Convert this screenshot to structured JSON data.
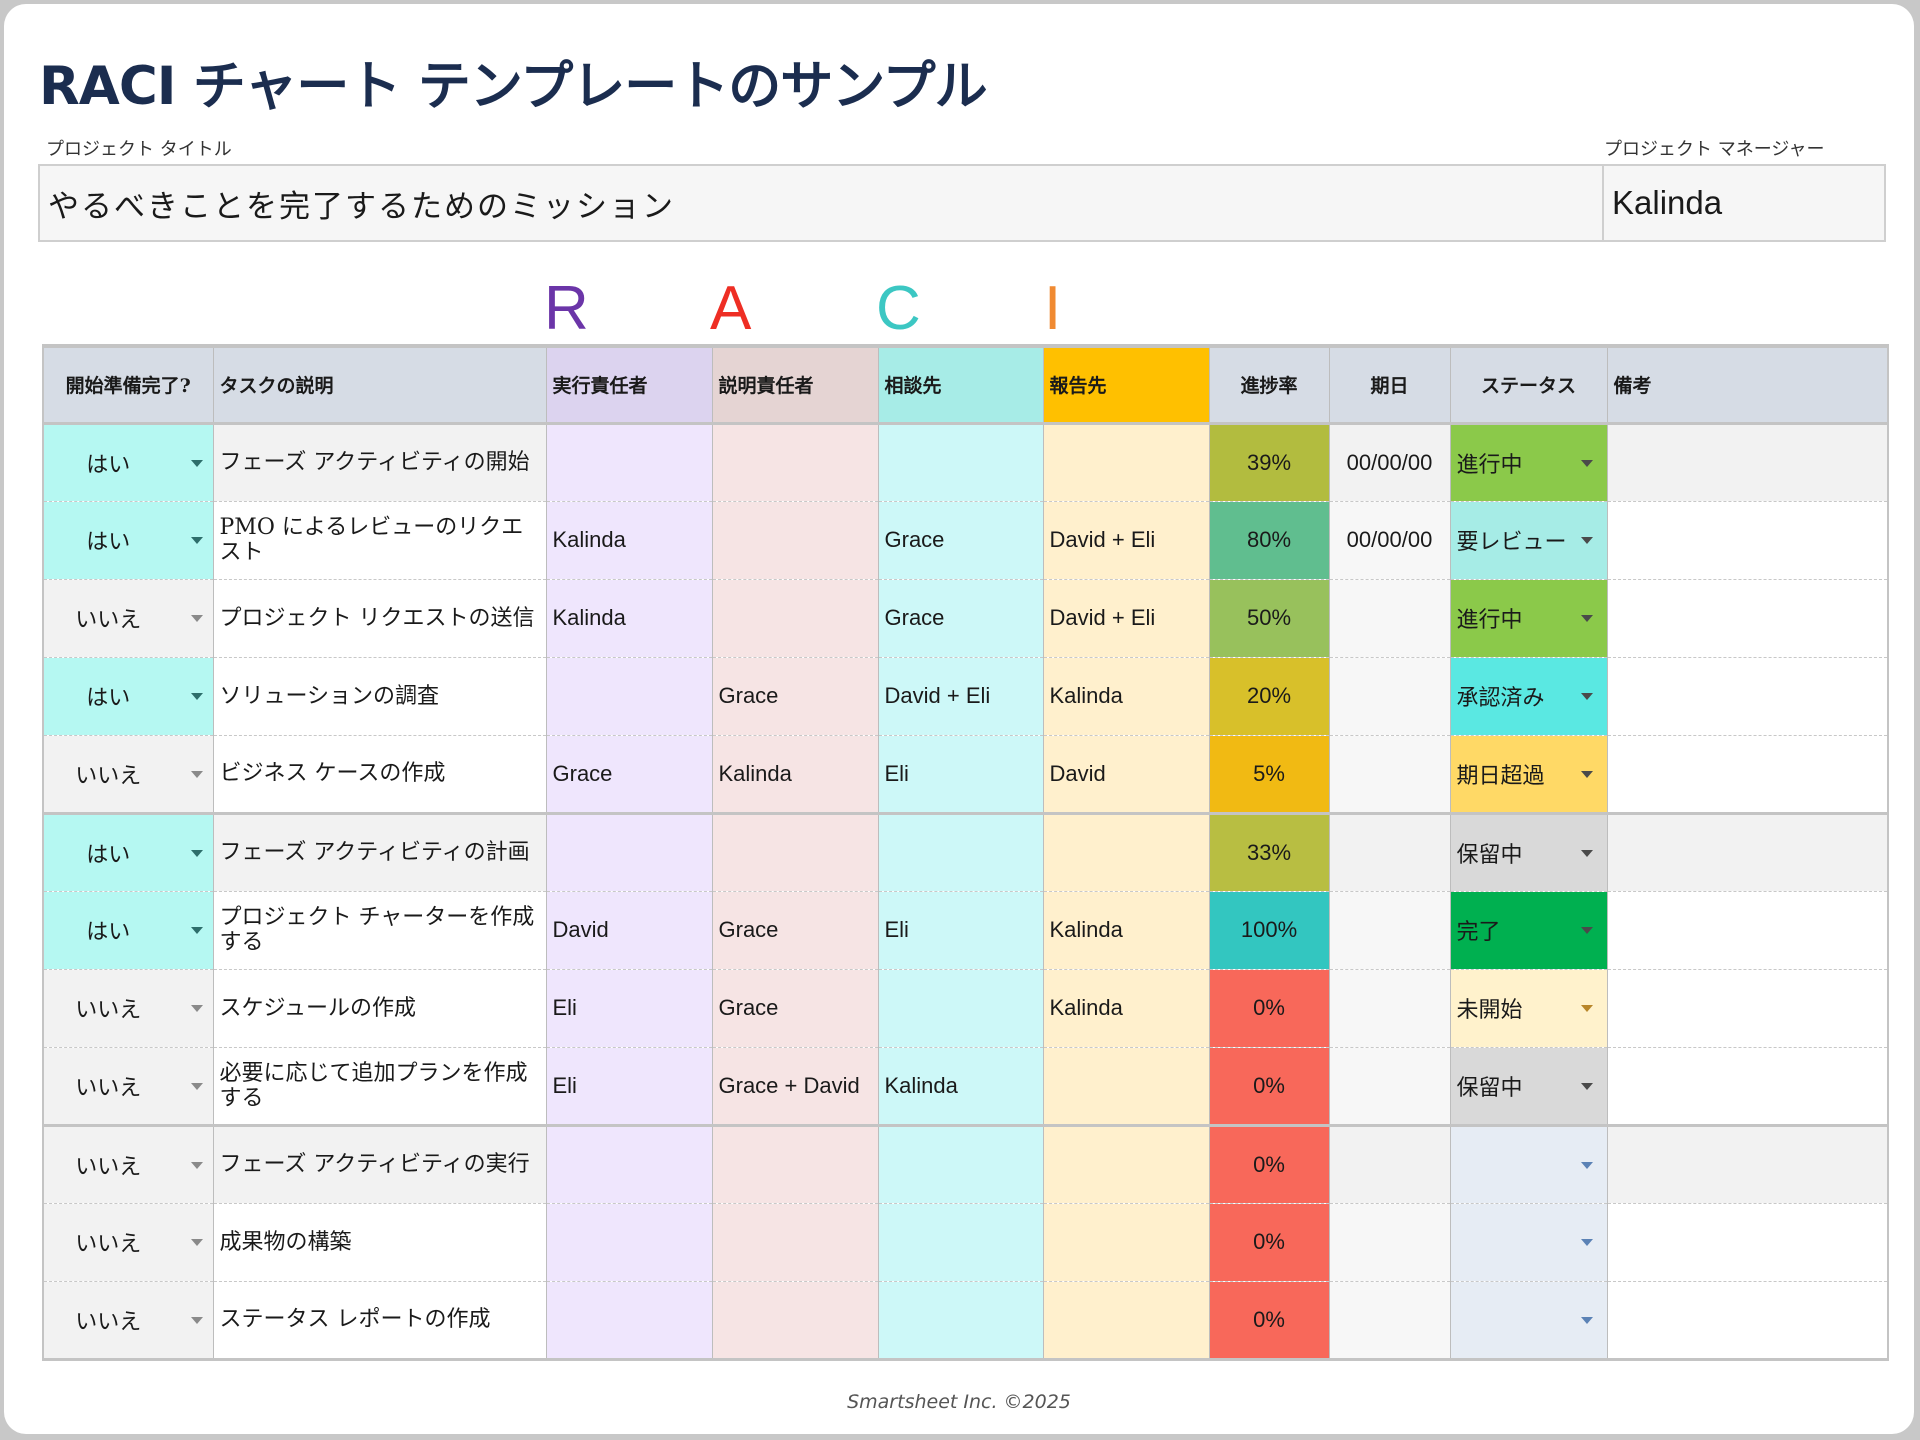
{
  "title": "RACI チャート テンプレートのサンプル",
  "project_title_label": "プロジェクト タイトル",
  "project_title": "やるべきことを完了するためのミッション",
  "project_manager_label": "プロジェクト マネージャー",
  "project_manager": "Kalinda",
  "raci_letters": [
    {
      "letter": "R",
      "color": "#6b35a8"
    },
    {
      "letter": "A",
      "color": "#ee2e24"
    },
    {
      "letter": "C",
      "color": "#3cc7c3"
    },
    {
      "letter": "I",
      "color": "#f08a32"
    }
  ],
  "headers": {
    "ready": "開始準備完了?",
    "task": "タスクの説明",
    "responsible": "実行責任者",
    "accountable": "説明責任者",
    "consulted": "相談先",
    "informed": "報告先",
    "progress": "進捗率",
    "due": "期日",
    "status": "ステータス",
    "notes": "備考"
  },
  "rows": [
    {
      "ready": "はい",
      "task": "フェーズ アクティビティの開始",
      "responsible": "",
      "accountable": "",
      "consulted": "",
      "informed": "",
      "progress": "39%",
      "progress_color": "#b2bc3f",
      "due": "00/00/00",
      "status": "進行中",
      "status_color": "#8bc94a",
      "phase": true
    },
    {
      "ready": "はい",
      "task": "PMO によるレビューのリクエスト",
      "responsible": "Kalinda",
      "accountable": "",
      "consulted": "Grace",
      "informed": "David + Eli",
      "progress": "80%",
      "progress_color": "#60be8f",
      "due": "00/00/00",
      "status": "要レビュー",
      "status_color": "#a6ece6"
    },
    {
      "ready": "いいえ",
      "task": "プロジェクト リクエストの送信",
      "responsible": "Kalinda",
      "accountable": "",
      "consulted": "Grace",
      "informed": "David + Eli",
      "progress": "50%",
      "progress_color": "#98c15c",
      "due": "",
      "status": "進行中",
      "status_color": "#8bc94a"
    },
    {
      "ready": "はい",
      "task": "ソリューションの調査",
      "responsible": "",
      "accountable": "Grace",
      "consulted": "David + Eli",
      "informed": "Kalinda",
      "progress": "20%",
      "progress_color": "#d8c02a",
      "due": "",
      "status": "承認済み",
      "status_color": "#5ae8e2"
    },
    {
      "ready": "いいえ",
      "task": "ビジネス ケースの作成",
      "responsible": "Grace",
      "accountable": "Kalinda",
      "consulted": "Eli",
      "informed": "David",
      "progress": "5%",
      "progress_color": "#f1ba13",
      "due": "",
      "status": "期日超過",
      "status_color": "#ffd966",
      "group_end": true
    },
    {
      "ready": "はい",
      "task": "フェーズ アクティビティの計画",
      "responsible": "",
      "accountable": "",
      "consulted": "",
      "informed": "",
      "progress": "33%",
      "progress_color": "#b8be42",
      "due": "",
      "status": "保留中",
      "status_color": "#d9d9d9",
      "phase": true
    },
    {
      "ready": "はい",
      "task": "プロジェクト チャーターを作成する",
      "responsible": "David",
      "accountable": "Grace",
      "consulted": "Eli",
      "informed": "Kalinda",
      "progress": "100%",
      "progress_color": "#33c6c0",
      "due": "",
      "status": "完了",
      "status_color": "#00b050"
    },
    {
      "ready": "いいえ",
      "task": "スケジュールの作成",
      "responsible": "Eli",
      "accountable": "Grace",
      "consulted": "",
      "informed": "Kalinda",
      "progress": "0%",
      "progress_color": "#f8685a",
      "due": "",
      "status": "未開始",
      "status_color": "#fff2cc"
    },
    {
      "ready": "いいえ",
      "task": "必要に応じて追加プランを作成する",
      "responsible": "Eli",
      "accountable": "Grace + David",
      "consulted": "Kalinda",
      "informed": "",
      "progress": "0%",
      "progress_color": "#f8685a",
      "due": "",
      "status": "保留中",
      "status_color": "#d9d9d9",
      "group_end": true
    },
    {
      "ready": "いいえ",
      "task": "フェーズ アクティビティの実行",
      "responsible": "",
      "accountable": "",
      "consulted": "",
      "informed": "",
      "progress": "0%",
      "progress_color": "#f8685a",
      "due": "",
      "status": "",
      "status_color": "#e6ecf4",
      "phase": true
    },
    {
      "ready": "いいえ",
      "task": "成果物の構築",
      "responsible": "",
      "accountable": "",
      "consulted": "",
      "informed": "",
      "progress": "0%",
      "progress_color": "#f8685a",
      "due": "",
      "status": "",
      "status_color": "#e6ecf4"
    },
    {
      "ready": "いいえ",
      "task": "ステータス レポートの作成",
      "responsible": "",
      "accountable": "",
      "consulted": "",
      "informed": "",
      "progress": "0%",
      "progress_color": "#f8685a",
      "due": "",
      "status": "",
      "status_color": "#e6ecf4",
      "group_end": true
    }
  ],
  "footer": "Smartsheet Inc. ©2025"
}
